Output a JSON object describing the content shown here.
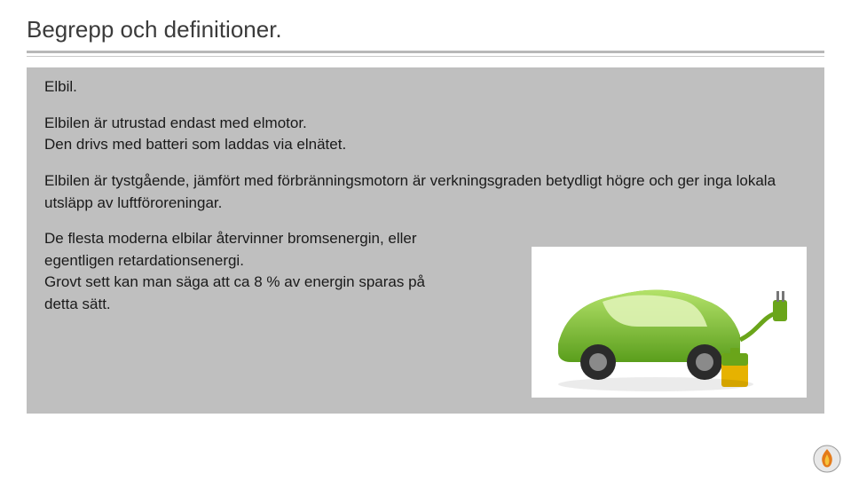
{
  "slide": {
    "title": "Begrepp och definitioner.",
    "subtitle": "Elbil.",
    "p1": "Elbilen är utrustad endast med elmotor.",
    "p2": "Den drivs med batteri som laddas via elnätet.",
    "p3": "Elbilen är tystgående, jämfört med förbränningsmotorn är verkningsgraden betydligt högre och ger inga lokala utsläpp av luftföroreningar.",
    "p4": "De flesta moderna elbilar återvinner bromsenergin, eller egentligen retardationsenergi.",
    "p5": "Grovt sett kan man säga att ca 8 % av energin sparas på detta sätt."
  },
  "image": {
    "name": "green-electric-car-with-plug-illustration"
  },
  "logo": {
    "name": "fire-emblem-logo"
  }
}
